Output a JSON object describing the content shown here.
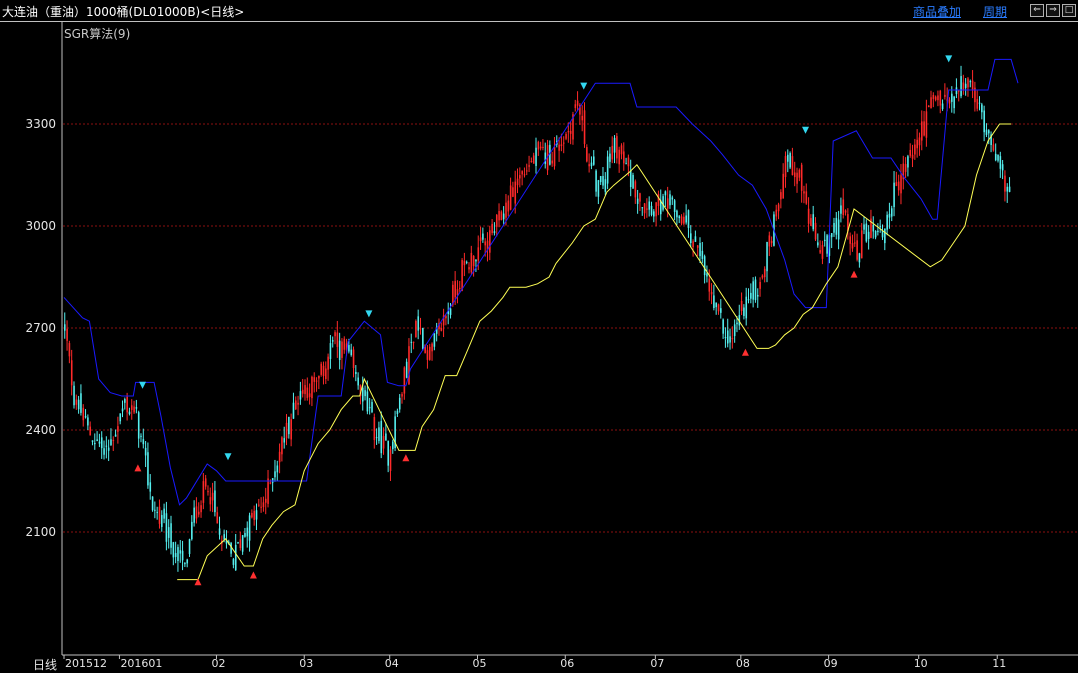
{
  "window": {
    "title": "大连油（重油）1000桶(DL01000B)<日线>"
  },
  "toolbar": {
    "overlay_label": "商品叠加",
    "period_label": "周期",
    "prev_icon": "arrow-left-box-icon",
    "next_icon": "arrow-right-box-icon",
    "window_icon": "window-split-icon"
  },
  "indicator": {
    "label": "SGR算法(9)"
  },
  "footer": {
    "period": "日线"
  },
  "colors": {
    "background": "#000000",
    "up_candle": "#ff2a2a",
    "down_candle": "#55f0f0",
    "upper_line": "#1a1aff",
    "lower_line": "#ffff55",
    "grid": "#8b1010",
    "buy_marker": "#ff3030",
    "sell_marker": "#33d8f0"
  },
  "chart_data": {
    "type": "candlestick",
    "yticks": [
      2100,
      2400,
      2700,
      3000,
      3300
    ],
    "ylim": [
      1940,
      3490
    ],
    "xticks": [
      "201512",
      "201601",
      "02",
      "03",
      "04",
      "05",
      "06",
      "07",
      "08",
      "09",
      "10",
      "11"
    ],
    "series": [
      {
        "name": "upper_band",
        "values": [
          [
            0,
            2790
          ],
          [
            8,
            2730
          ],
          [
            11,
            2720
          ],
          [
            15,
            2550
          ],
          [
            20,
            2510
          ],
          [
            25,
            2500
          ],
          [
            30,
            2500
          ],
          [
            31,
            2540
          ],
          [
            39,
            2540
          ],
          [
            42,
            2440
          ],
          [
            46,
            2290
          ],
          [
            50,
            2180
          ],
          [
            53,
            2200
          ],
          [
            62,
            2300
          ],
          [
            66,
            2280
          ],
          [
            70,
            2250
          ],
          [
            105,
            2250
          ],
          [
            110,
            2500
          ],
          [
            120,
            2500
          ],
          [
            123,
            2660
          ],
          [
            130,
            2720
          ],
          [
            137,
            2680
          ],
          [
            140,
            2540
          ],
          [
            145,
            2530
          ],
          [
            148,
            2530
          ],
          [
            150,
            2580
          ],
          [
            230,
            3420
          ],
          [
            245,
            3420
          ],
          [
            248,
            3350
          ],
          [
            265,
            3350
          ],
          [
            272,
            3300
          ],
          [
            280,
            3250
          ],
          [
            285,
            3210
          ],
          [
            292,
            3150
          ],
          [
            298,
            3120
          ],
          [
            304,
            3050
          ],
          [
            312,
            2900
          ],
          [
            316,
            2800
          ],
          [
            321,
            2760
          ],
          [
            330,
            2760
          ],
          [
            333,
            3250
          ],
          [
            343,
            3280
          ],
          [
            350,
            3200
          ],
          [
            358,
            3200
          ],
          [
            364,
            3140
          ],
          [
            371,
            3080
          ],
          [
            376,
            3020
          ],
          [
            378,
            3020
          ],
          [
            383,
            3400
          ],
          [
            400,
            3400
          ],
          [
            403,
            3490
          ],
          [
            410,
            3490
          ],
          [
            413,
            3420
          ]
        ]
      },
      {
        "name": "lower_band",
        "values": [
          [
            49,
            1960
          ],
          [
            58,
            1960
          ],
          [
            62,
            2030
          ],
          [
            70,
            2080
          ],
          [
            78,
            2000
          ],
          [
            82,
            2000
          ],
          [
            86,
            2080
          ],
          [
            90,
            2120
          ],
          [
            95,
            2160
          ],
          [
            100,
            2180
          ],
          [
            104,
            2280
          ],
          [
            110,
            2360
          ],
          [
            115,
            2400
          ],
          [
            120,
            2460
          ],
          [
            125,
            2500
          ],
          [
            128,
            2500
          ],
          [
            130,
            2550
          ],
          [
            145,
            2340
          ],
          [
            152,
            2340
          ],
          [
            155,
            2410
          ],
          [
            160,
            2460
          ],
          [
            165,
            2560
          ],
          [
            170,
            2560
          ],
          [
            175,
            2640
          ],
          [
            180,
            2720
          ],
          [
            185,
            2750
          ],
          [
            190,
            2790
          ],
          [
            193,
            2820
          ],
          [
            200,
            2820
          ],
          [
            205,
            2830
          ],
          [
            210,
            2850
          ],
          [
            213,
            2890
          ],
          [
            220,
            2950
          ],
          [
            225,
            3000
          ],
          [
            230,
            3020
          ],
          [
            235,
            3100
          ],
          [
            238,
            3120
          ],
          [
            245,
            3160
          ],
          [
            248,
            3180
          ],
          [
            250,
            3160
          ],
          [
            300,
            2640
          ],
          [
            305,
            2640
          ],
          [
            308,
            2650
          ],
          [
            312,
            2680
          ],
          [
            316,
            2700
          ],
          [
            320,
            2740
          ],
          [
            324,
            2760
          ],
          [
            330,
            2830
          ],
          [
            335,
            2880
          ],
          [
            342,
            3050
          ],
          [
            375,
            2880
          ],
          [
            380,
            2900
          ],
          [
            385,
            2950
          ],
          [
            390,
            3000
          ],
          [
            395,
            3150
          ],
          [
            400,
            3250
          ],
          [
            405,
            3300
          ],
          [
            410,
            3300
          ]
        ]
      }
    ],
    "markers": [
      {
        "type": "buy",
        "x": 32,
        "value": 2290
      },
      {
        "type": "sell",
        "x": 34,
        "value": 2530
      },
      {
        "type": "buy",
        "x": 58,
        "value": 1955
      },
      {
        "type": "sell",
        "x": 71,
        "value": 2320
      },
      {
        "type": "buy",
        "x": 82,
        "value": 1975
      },
      {
        "type": "sell",
        "x": 132,
        "value": 2740
      },
      {
        "type": "buy",
        "x": 148,
        "value": 2320
      },
      {
        "type": "sell",
        "x": 225,
        "value": 3410
      },
      {
        "type": "buy",
        "x": 295,
        "value": 2630
      },
      {
        "type": "sell",
        "x": 321,
        "value": 3280
      },
      {
        "type": "buy",
        "x": 342,
        "value": 2860
      },
      {
        "type": "sell",
        "x": 383,
        "value": 3490
      }
    ],
    "anchors": [
      [
        0,
        2700,
        -1
      ],
      [
        4,
        2500,
        -1
      ],
      [
        10,
        2400,
        -1
      ],
      [
        18,
        2330,
        -1
      ],
      [
        26,
        2480,
        1
      ],
      [
        31,
        2440,
        -1
      ],
      [
        38,
        2180,
        -1
      ],
      [
        45,
        2080,
        -1
      ],
      [
        52,
        1990,
        -1
      ],
      [
        56,
        2150,
        1
      ],
      [
        62,
        2250,
        1
      ],
      [
        67,
        2080,
        -1
      ],
      [
        73,
        2020,
        -1
      ],
      [
        78,
        2110,
        1
      ],
      [
        86,
        2180,
        1
      ],
      [
        94,
        2360,
        1
      ],
      [
        102,
        2520,
        1
      ],
      [
        110,
        2540,
        1
      ],
      [
        116,
        2660,
        1
      ],
      [
        122,
        2620,
        -1
      ],
      [
        128,
        2520,
        -1
      ],
      [
        134,
        2400,
        -1
      ],
      [
        140,
        2330,
        -1
      ],
      [
        146,
        2520,
        1
      ],
      [
        152,
        2720,
        1
      ],
      [
        158,
        2620,
        1
      ],
      [
        166,
        2760,
        1
      ],
      [
        172,
        2870,
        1
      ],
      [
        178,
        2920,
        1
      ],
      [
        184,
        2960,
        1
      ],
      [
        190,
        3040,
        1
      ],
      [
        196,
        3140,
        1
      ],
      [
        204,
        3200,
        1
      ],
      [
        212,
        3220,
        1
      ],
      [
        218,
        3280,
        1
      ],
      [
        222,
        3370,
        1
      ],
      [
        227,
        3180,
        -1
      ],
      [
        232,
        3100,
        -1
      ],
      [
        238,
        3250,
        1
      ],
      [
        244,
        3150,
        -1
      ],
      [
        250,
        3080,
        -1
      ],
      [
        256,
        3060,
        -1
      ],
      [
        262,
        3060,
        -1
      ],
      [
        270,
        3000,
        -1
      ],
      [
        276,
        2880,
        -1
      ],
      [
        282,
        2740,
        -1
      ],
      [
        288,
        2660,
        -1
      ],
      [
        294,
        2770,
        -1
      ],
      [
        300,
        2820,
        1
      ],
      [
        306,
        2980,
        1
      ],
      [
        312,
        3200,
        1
      ],
      [
        318,
        3150,
        1
      ],
      [
        324,
        2960,
        -1
      ],
      [
        330,
        2920,
        -1
      ],
      [
        336,
        3050,
        1
      ],
      [
        342,
        2920,
        -1
      ],
      [
        348,
        3000,
        -1
      ],
      [
        354,
        2980,
        -1
      ],
      [
        360,
        3120,
        1
      ],
      [
        368,
        3230,
        1
      ],
      [
        376,
        3370,
        1
      ],
      [
        384,
        3360,
        1
      ],
      [
        390,
        3430,
        1
      ],
      [
        396,
        3340,
        -1
      ],
      [
        402,
        3250,
        -1
      ],
      [
        406,
        3130,
        -1
      ]
    ]
  }
}
